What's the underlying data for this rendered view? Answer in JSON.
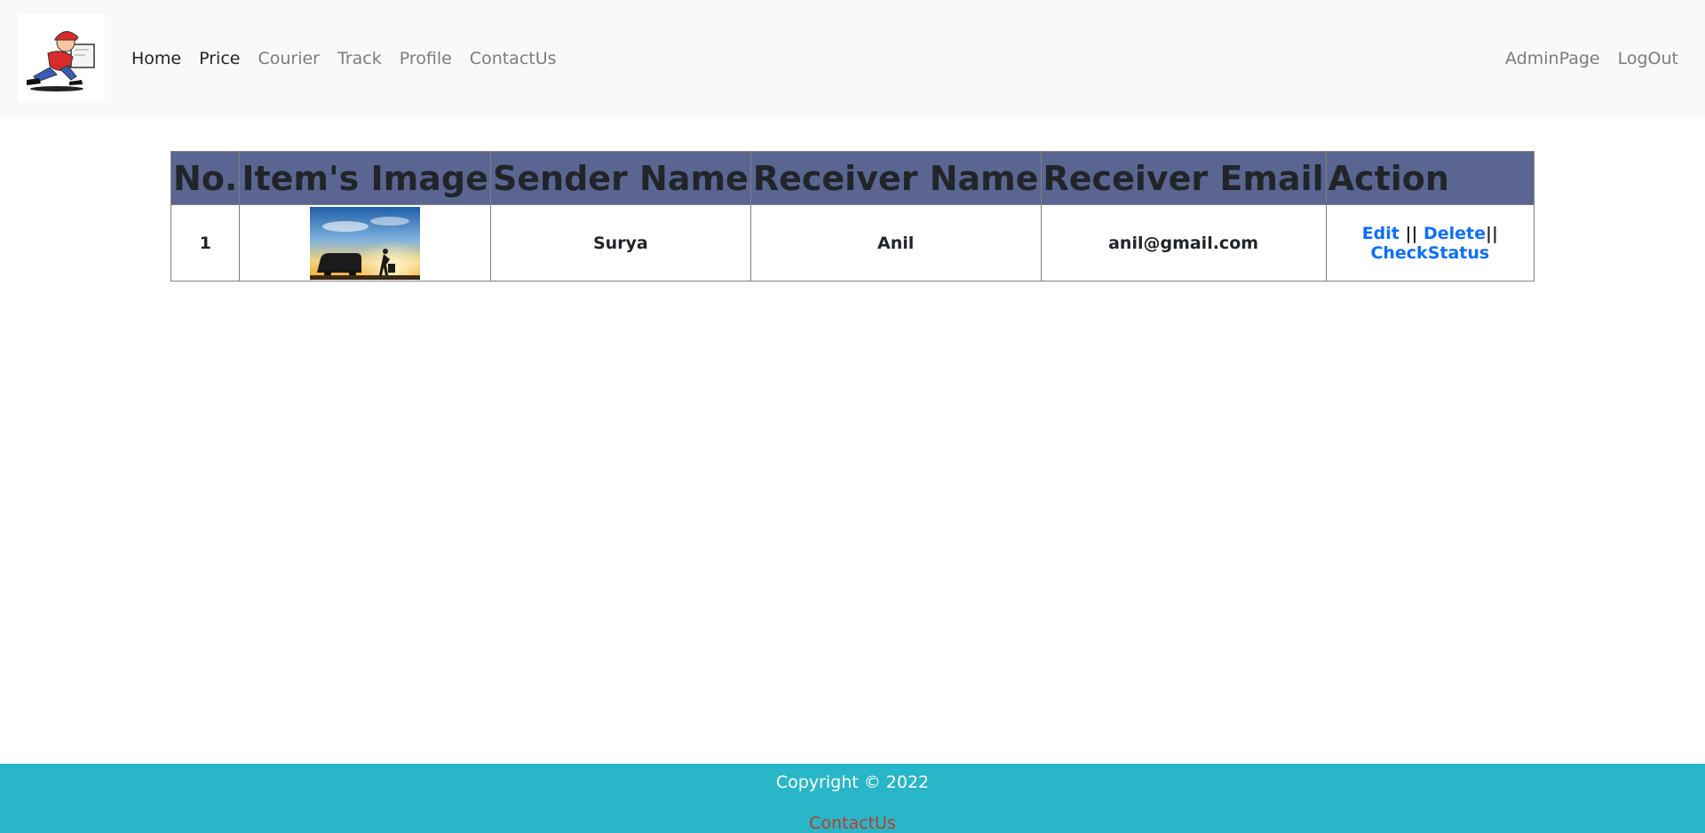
{
  "navbar": {
    "logo_icon": "courier-runner-logo",
    "left_links": [
      {
        "label": "Home",
        "state": "active"
      },
      {
        "label": "Price",
        "state": "active"
      },
      {
        "label": "Courier",
        "state": "muted"
      },
      {
        "label": "Track",
        "state": "muted"
      },
      {
        "label": "Profile",
        "state": "muted"
      },
      {
        "label": "ContactUs",
        "state": "muted"
      }
    ],
    "right_links": [
      {
        "label": "AdminPage"
      },
      {
        "label": "LogOut"
      }
    ]
  },
  "table": {
    "headers": [
      "No.",
      "Item's Image",
      "Sender Name",
      "Receiver Name",
      "Receiver Email",
      "Action"
    ],
    "rows": [
      {
        "no": "1",
        "image_icon": "delivery-van-sunset-photo",
        "sender": "Surya",
        "receiver": "Anil",
        "email": "anil@gmail.com",
        "actions": {
          "edit": "Edit",
          "sep1": " || ",
          "delete": "Delete",
          "sep2": "|| ",
          "check": "CheckStatus"
        }
      }
    ]
  },
  "footer": {
    "copyright": "Copyright © 2022",
    "link": "ContactUs"
  },
  "colors": {
    "header_bg": "#5a6691",
    "footer_bg": "#29b6c8",
    "link_blue": "#0d6efd",
    "footer_link": "#c0392b"
  }
}
